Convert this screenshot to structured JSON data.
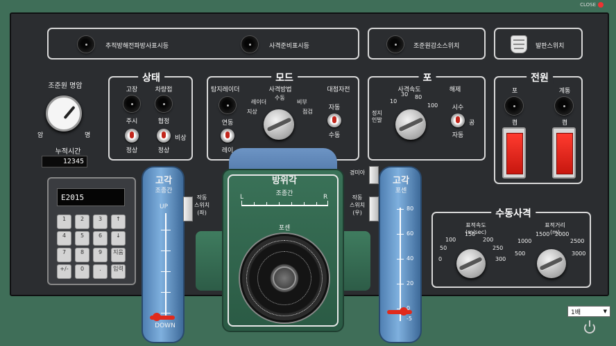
{
  "window": {
    "close_label": "CLOSE"
  },
  "top_row": {
    "item1": "추적방해전파방사표시등",
    "item2": "사격준비표시등",
    "item3": "조준원감소스위치",
    "item4": "발판스위치"
  },
  "reticle": {
    "title": "조준원 명암",
    "left": "암",
    "right": "명",
    "hours_label": "누적시간",
    "hours_value": "12345"
  },
  "status": {
    "title": "상태",
    "lamp1": "고장",
    "lamp2": "차량접",
    "lamp1_sub": "주시",
    "lamp2_sub": "협정",
    "sw1": "정상",
    "sw2": "정상",
    "sw2_side": "비상"
  },
  "mode": {
    "title": "모드",
    "radar": "탐지레이더",
    "radar_sw": "연동",
    "radar_sw2": "레이",
    "fire_method": "사격방법",
    "fm_opts": [
      "레이더",
      "지상",
      "수동",
      "비부",
      "점검"
    ],
    "target": "대점자전",
    "target_a": "자동",
    "target_b": "수동"
  },
  "gun": {
    "title": "포",
    "rate": "사격속도",
    "rate_opts": [
      "10",
      "30",
      "80",
      "100"
    ],
    "stop": "정지",
    "stop_sub": "인발",
    "release": "해제",
    "rel_a": "시수",
    "rel_b": "자동",
    "rel_c": "공"
  },
  "power": {
    "title": "전원",
    "a": "포",
    "b": "계통",
    "a_sub": "켬",
    "b_sub": "켬"
  },
  "keypad": {
    "display": "E2015",
    "keys": [
      "1",
      "2",
      "3",
      "↑",
      "4",
      "5",
      "6",
      "↓",
      "7",
      "8",
      "9",
      "지움",
      "+/-",
      "0",
      ".",
      "입력"
    ]
  },
  "elev_left": {
    "title": "고각",
    "sub": "조종간",
    "up": "UP",
    "down": "DOWN",
    "switch_label": "작동\n스위치\n(좌)"
  },
  "azimuth": {
    "title": "방위각",
    "sub": "조종간",
    "left": "L",
    "right": "R",
    "handle": "포센"
  },
  "elev_right": {
    "title": "고각",
    "sub": "포센",
    "ticks": [
      "80",
      "60",
      "40",
      "20",
      "0",
      "-5"
    ],
    "top_sw": "경미아",
    "switch_label": "작동\n스위치\n(우)"
  },
  "manual": {
    "title": "수동사격",
    "speed": "표적속도\n(m/sec)",
    "speed_opts": [
      "0",
      "50",
      "100",
      "150",
      "200",
      "250",
      "300"
    ],
    "dist": "표적거리\n(m)",
    "dist_opts": [
      "500",
      "1000",
      "1500",
      "2000",
      "2500",
      "3000"
    ]
  },
  "footer": {
    "zoom": "1배"
  },
  "colors": {
    "bg": "#3f6e58",
    "panel": "#2b2d30",
    "rail": "#6fa0d0",
    "center": "#2f6148"
  }
}
